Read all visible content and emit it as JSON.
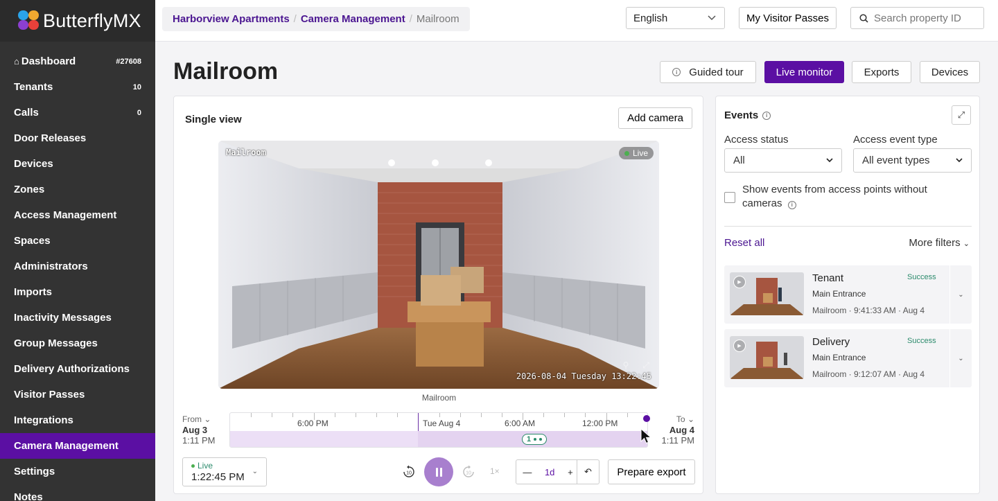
{
  "app": {
    "brand": "ButterflyMX"
  },
  "sidebar": {
    "items": [
      {
        "label": "Dashboard",
        "badge": "#27608"
      },
      {
        "label": "Tenants",
        "badge": "10"
      },
      {
        "label": "Calls",
        "badge": "0"
      },
      {
        "label": "Door Releases",
        "badge": ""
      },
      {
        "label": "Devices",
        "badge": ""
      },
      {
        "label": "Zones",
        "badge": ""
      },
      {
        "label": "Access Management",
        "badge": ""
      },
      {
        "label": "Spaces",
        "badge": ""
      },
      {
        "label": "Administrators",
        "badge": ""
      },
      {
        "label": "Imports",
        "badge": ""
      },
      {
        "label": "Inactivity Messages",
        "badge": ""
      },
      {
        "label": "Group Messages",
        "badge": ""
      },
      {
        "label": "Delivery Authorizations",
        "badge": ""
      },
      {
        "label": "Visitor Passes",
        "badge": ""
      },
      {
        "label": "Integrations",
        "badge": ""
      },
      {
        "label": "Camera Management",
        "badge": ""
      },
      {
        "label": "Settings",
        "badge": ""
      },
      {
        "label": "Notes",
        "badge": ""
      }
    ],
    "active_index": 15
  },
  "topbar": {
    "breadcrumb": [
      "Harborview Apartments",
      "Camera Management",
      "Mailroom"
    ],
    "language": "English",
    "visitor_passes_label": "My Visitor Passes",
    "search_placeholder": "Search property ID"
  },
  "page": {
    "title": "Mailroom",
    "guided_tour_label": "Guided tour",
    "live_monitor_label": "Live monitor",
    "exports_label": "Exports",
    "devices_label": "Devices"
  },
  "viewer": {
    "title": "Single view",
    "add_camera_label": "Add camera",
    "camera_overlay": "Mailroom",
    "live_badge": "Live",
    "timestamp": "2026-08-04 Tuesday 13:22:45",
    "caption": "Mailroom"
  },
  "timeline": {
    "from_label": "From",
    "from_date": "Aug 3",
    "from_time": "1:11 PM",
    "to_label": "To",
    "to_date": "Aug 4",
    "to_time": "1:11 PM",
    "labels": [
      "6:00 PM",
      "Tue Aug 4",
      "6:00 AM",
      "12:00 PM"
    ],
    "cluster_count": "1",
    "progress": 1.0
  },
  "controls": {
    "live_label": "Live",
    "live_time": "1:22:45 PM",
    "rewind_label": "10",
    "forward_label": "10",
    "speed": "1×",
    "zoom_value": "1d",
    "prepare_export_label": "Prepare export"
  },
  "events": {
    "title": "Events",
    "access_status_label": "Access status",
    "access_status_value": "All",
    "access_type_label": "Access event type",
    "access_type_value": "All event types",
    "checkbox_label": "Show events from access points without cameras",
    "reset_label": "Reset all",
    "more_filters_label": "More filters",
    "items": [
      {
        "name": "Tenant",
        "status": "Success",
        "location": "Main Entrance",
        "meta": "Mailroom · 9:41:33 AM · Aug 4"
      },
      {
        "name": "Delivery",
        "status": "Success",
        "location": "Main Entrance",
        "meta": "Mailroom · 9:12:07 AM · Aug 4"
      }
    ]
  },
  "colors": {
    "sidebar_bg": "#333333",
    "accent": "#5b0fa3",
    "link": "#4b1691",
    "success": "#2a8a6b"
  }
}
